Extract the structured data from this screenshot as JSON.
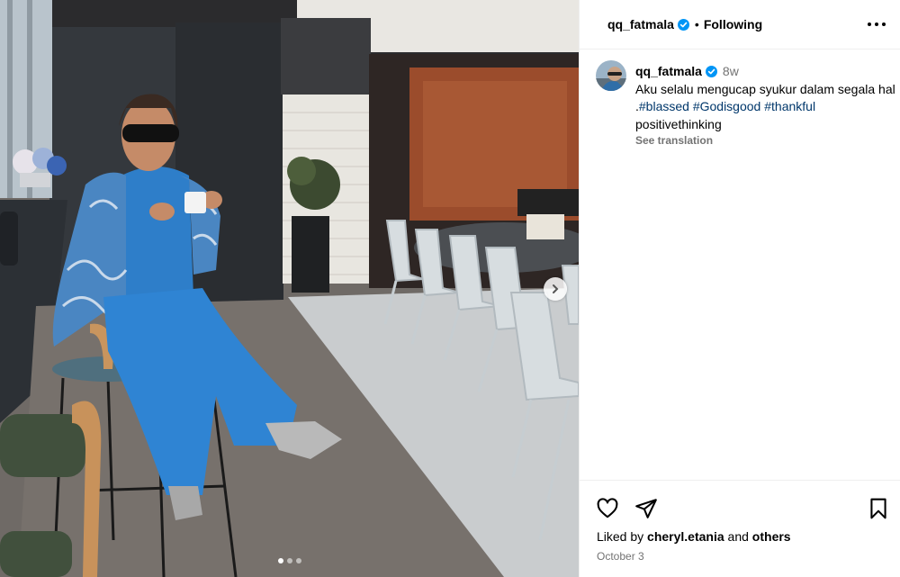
{
  "post": {
    "username": "qq_fatmala",
    "follow_label": "Following",
    "separator": "•",
    "time_ago": "8w",
    "caption_text": "Aku selalu mengucap syukur dalam segala hal .",
    "hashtags": [
      "#blassed",
      "#Godisgood",
      "#thankful"
    ],
    "caption_tail": "positivethinking",
    "see_translation": "See translation",
    "liked_prefix": "Liked by",
    "liked_user": "cheryl.etania",
    "liked_and": "and",
    "liked_others": "others",
    "date": "October 3"
  },
  "carousel": {
    "slides": 3,
    "active_index": 0
  },
  "icons": {
    "verified": "verified-badge-icon",
    "more": "more-options-icon",
    "like": "heart-icon",
    "share": "paper-plane-icon",
    "save": "bookmark-icon",
    "next": "chevron-right-icon"
  },
  "colors": {
    "verified": "#0095f6",
    "hashtag": "#00376b",
    "muted": "#737373",
    "divider": "#efefef"
  }
}
